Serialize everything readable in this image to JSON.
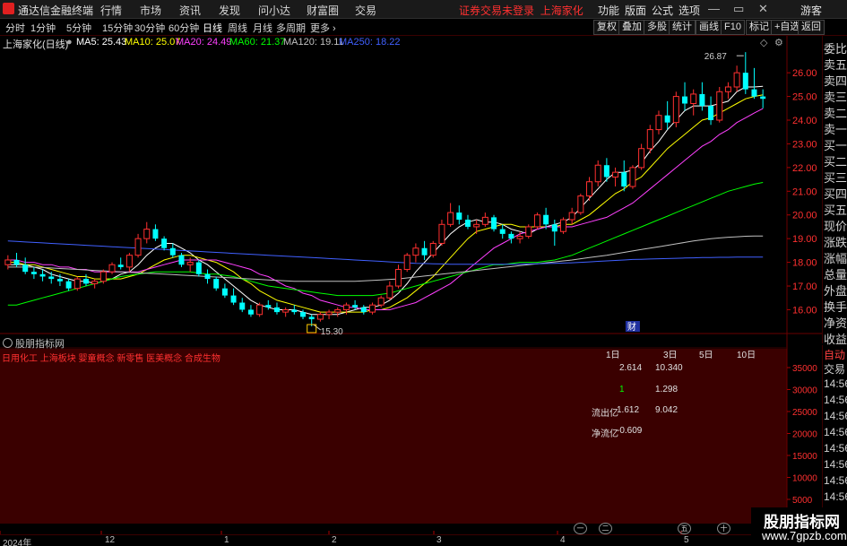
{
  "titlebar": {
    "app_title": "通达信金融终端",
    "menus": [
      "行情",
      "市场",
      "资讯",
      "发现",
      "问小达",
      "财富圈",
      "交易"
    ],
    "notice": "证券交易未登录",
    "notice_stock": "上海家化",
    "right_menus": [
      "功能",
      "版面",
      "公式",
      "选项"
    ],
    "guest": "游客",
    "win_min": "—",
    "win_max": "▭",
    "win_close": "✕"
  },
  "toolbar": {
    "periods": [
      "分时",
      "1分钟",
      "5分钟",
      "15分钟",
      "30分钟",
      "60分钟",
      "日线",
      "周线",
      "月线",
      "多周期",
      "更多"
    ],
    "active_period": "日线",
    "buttons": [
      "复权",
      "叠加",
      "多股",
      "统计",
      "画线",
      "F10",
      "标记",
      "+自选",
      "返回"
    ]
  },
  "chart_header": {
    "stock": "上海家化(日线)",
    "ma": [
      {
        "label": "MA5: 25.43",
        "color": "#ffffff"
      },
      {
        "label": "MA10: 25.07",
        "color": "#ffff00"
      },
      {
        "label": "MA20: 24.49",
        "color": "#ff40ff"
      },
      {
        "label": "MA60: 21.37",
        "color": "#00ff00"
      },
      {
        "label": "MA120: 19.11",
        "color": "#c0c0c0"
      },
      {
        "label": "MA250: 18.22",
        "color": "#4060ff"
      }
    ]
  },
  "quote_side": [
    "委比",
    "卖五",
    "卖四",
    "卖三",
    "卖二",
    "卖一",
    "买一",
    "买二",
    "买三",
    "买四",
    "买五",
    "现价",
    "涨跌",
    "涨幅",
    "总量",
    "外盘",
    "换手",
    "净资",
    "收益"
  ],
  "tick_side": [
    "自动",
    "交易",
    "14:56",
    "14:56",
    "14:56",
    "14:56",
    "14:56",
    "14:56",
    "14:56",
    "14:56"
  ],
  "chart_data": {
    "type": "candlestick",
    "price_axis_ticks": [
      "26.00",
      "25.00",
      "24.00",
      "23.00",
      "22.00",
      "21.00",
      "20.00",
      "19.00",
      "18.00",
      "17.00",
      "16.00"
    ],
    "y_range": [
      15.45,
      26.8
    ],
    "annotations": {
      "high": "26.87",
      "low": "15.30",
      "marker": "财"
    },
    "candles": [
      [
        17.9,
        18.3,
        17.7,
        18.1
      ],
      [
        18.1,
        18.4,
        17.8,
        17.9
      ],
      [
        17.9,
        18.2,
        17.5,
        17.6
      ],
      [
        17.6,
        17.8,
        17.3,
        17.5
      ],
      [
        17.5,
        17.7,
        17.2,
        17.4
      ],
      [
        17.4,
        17.6,
        17.1,
        17.3
      ],
      [
        17.3,
        17.5,
        17.0,
        17.2
      ],
      [
        17.2,
        17.3,
        16.8,
        16.9
      ],
      [
        16.9,
        17.4,
        16.8,
        17.3
      ],
      [
        17.3,
        17.5,
        17.0,
        17.1
      ],
      [
        17.1,
        17.3,
        16.9,
        17.2
      ],
      [
        17.2,
        17.7,
        17.1,
        17.6
      ],
      [
        17.6,
        18.0,
        17.5,
        17.9
      ],
      [
        17.9,
        18.2,
        17.7,
        17.8
      ],
      [
        17.8,
        18.4,
        17.6,
        18.3
      ],
      [
        18.3,
        19.2,
        18.2,
        19.0
      ],
      [
        19.0,
        19.7,
        18.8,
        19.4
      ],
      [
        19.4,
        19.6,
        18.9,
        19.0
      ],
      [
        19.0,
        19.1,
        18.5,
        18.6
      ],
      [
        18.6,
        18.8,
        18.2,
        18.3
      ],
      [
        18.3,
        18.4,
        17.8,
        17.9
      ],
      [
        17.9,
        18.2,
        17.6,
        18.0
      ],
      [
        18.0,
        18.1,
        17.4,
        17.5
      ],
      [
        17.5,
        17.7,
        17.1,
        17.3
      ],
      [
        17.3,
        17.4,
        16.8,
        16.9
      ],
      [
        16.9,
        17.1,
        16.5,
        16.6
      ],
      [
        16.6,
        16.9,
        16.2,
        16.3
      ],
      [
        16.3,
        16.5,
        15.9,
        16.0
      ],
      [
        16.0,
        16.2,
        15.7,
        15.8
      ],
      [
        15.8,
        16.3,
        15.7,
        16.2
      ],
      [
        16.2,
        16.4,
        16.0,
        16.1
      ],
      [
        16.1,
        16.3,
        15.8,
        15.9
      ],
      [
        15.9,
        16.1,
        15.7,
        16.0
      ],
      [
        16.0,
        16.2,
        15.8,
        15.9
      ],
      [
        15.9,
        16.0,
        15.6,
        15.7
      ],
      [
        15.7,
        15.8,
        15.3,
        15.6
      ],
      [
        15.6,
        15.9,
        15.5,
        15.8
      ],
      [
        15.8,
        16.0,
        15.6,
        15.9
      ],
      [
        15.9,
        16.1,
        15.7,
        16.0
      ],
      [
        16.0,
        16.3,
        15.8,
        16.2
      ],
      [
        16.2,
        16.4,
        16.0,
        16.1
      ],
      [
        16.1,
        16.2,
        15.8,
        15.9
      ],
      [
        15.9,
        16.3,
        15.8,
        16.2
      ],
      [
        16.2,
        16.6,
        16.1,
        16.5
      ],
      [
        16.5,
        17.2,
        16.4,
        17.0
      ],
      [
        17.0,
        17.9,
        16.9,
        17.7
      ],
      [
        17.7,
        18.4,
        17.6,
        18.3
      ],
      [
        18.3,
        18.8,
        18.0,
        18.6
      ],
      [
        18.6,
        18.9,
        18.1,
        18.3
      ],
      [
        18.3,
        18.9,
        18.2,
        18.8
      ],
      [
        18.8,
        19.8,
        18.7,
        19.6
      ],
      [
        19.6,
        20.5,
        19.5,
        20.1
      ],
      [
        20.1,
        20.4,
        19.6,
        19.8
      ],
      [
        19.8,
        20.0,
        19.4,
        19.5
      ],
      [
        19.5,
        19.8,
        19.2,
        19.6
      ],
      [
        19.6,
        20.1,
        19.5,
        19.9
      ],
      [
        19.9,
        20.0,
        19.3,
        19.4
      ],
      [
        19.4,
        19.6,
        19.0,
        19.2
      ],
      [
        19.2,
        19.3,
        18.8,
        19.0
      ],
      [
        19.0,
        19.3,
        18.8,
        19.1
      ],
      [
        19.1,
        19.6,
        19.0,
        19.5
      ],
      [
        19.5,
        20.1,
        19.4,
        20.0
      ],
      [
        20.0,
        20.3,
        19.4,
        19.6
      ],
      [
        19.6,
        19.8,
        18.7,
        19.3
      ],
      [
        19.3,
        19.9,
        19.2,
        19.8
      ],
      [
        19.8,
        20.3,
        19.6,
        20.1
      ],
      [
        20.1,
        20.9,
        20.0,
        20.8
      ],
      [
        20.8,
        21.6,
        20.6,
        21.4
      ],
      [
        21.4,
        22.3,
        21.2,
        22.1
      ],
      [
        22.1,
        22.4,
        21.4,
        21.6
      ],
      [
        21.6,
        22.0,
        21.2,
        21.8
      ],
      [
        21.8,
        22.3,
        21.0,
        21.2
      ],
      [
        21.2,
        22.1,
        21.1,
        22.0
      ],
      [
        22.0,
        23.0,
        21.9,
        22.8
      ],
      [
        22.8,
        23.8,
        22.6,
        23.6
      ],
      [
        23.6,
        24.4,
        23.4,
        24.2
      ],
      [
        24.2,
        24.8,
        23.6,
        23.9
      ],
      [
        23.9,
        25.2,
        23.7,
        25.0
      ],
      [
        25.0,
        25.6,
        24.4,
        24.7
      ],
      [
        24.7,
        25.3,
        24.2,
        25.1
      ],
      [
        25.1,
        25.6,
        24.4,
        24.6
      ],
      [
        24.6,
        25.0,
        23.8,
        24.0
      ],
      [
        24.0,
        25.4,
        23.9,
        25.2
      ],
      [
        25.2,
        25.6,
        24.9,
        25.4
      ],
      [
        25.4,
        26.3,
        25.2,
        26.0
      ],
      [
        26.0,
        26.87,
        25.1,
        25.3
      ],
      [
        25.3,
        26.2,
        24.9,
        25.0
      ],
      [
        25.0,
        25.3,
        24.5,
        24.9
      ]
    ],
    "ma_series": {
      "MA5": [
        17.9,
        17.9,
        17.9,
        17.8,
        17.7,
        17.5,
        17.4,
        17.3,
        17.2,
        17.2,
        17.1,
        17.2,
        17.3,
        17.5,
        17.6,
        17.9,
        18.3,
        18.6,
        18.8,
        18.8,
        18.6,
        18.4,
        18.1,
        17.9,
        17.6,
        17.3,
        17.0,
        16.7,
        16.4,
        16.2,
        16.1,
        16.0,
        16.0,
        16.0,
        15.9,
        15.8,
        15.8,
        15.8,
        15.8,
        15.9,
        16.0,
        16.1,
        16.1,
        16.2,
        16.4,
        16.7,
        17.1,
        17.6,
        18.0,
        18.4,
        18.8,
        19.2,
        19.5,
        19.7,
        19.8,
        19.7,
        19.7,
        19.6,
        19.4,
        19.3,
        19.2,
        19.4,
        19.5,
        19.6,
        19.7,
        19.9,
        20.3,
        20.7,
        21.1,
        21.5,
        21.8,
        21.8,
        21.9,
        22.2,
        22.7,
        23.1,
        23.6,
        24.0,
        24.4,
        24.6,
        24.6,
        24.6,
        24.7,
        24.8,
        25.2,
        25.4,
        25.4,
        25.43
      ],
      "MA10": [
        18.0,
        18.0,
        17.9,
        17.9,
        17.8,
        17.7,
        17.6,
        17.5,
        17.4,
        17.4,
        17.3,
        17.3,
        17.3,
        17.3,
        17.4,
        17.5,
        17.7,
        17.9,
        18.1,
        18.2,
        18.3,
        18.3,
        18.2,
        18.1,
        18.0,
        17.8,
        17.6,
        17.3,
        17.1,
        16.8,
        16.6,
        16.4,
        16.3,
        16.2,
        16.1,
        16.0,
        15.9,
        15.9,
        15.9,
        15.9,
        15.9,
        15.9,
        16.0,
        16.0,
        16.1,
        16.3,
        16.5,
        16.8,
        17.1,
        17.4,
        17.8,
        18.2,
        18.6,
        19.0,
        19.3,
        19.4,
        19.5,
        19.6,
        19.6,
        19.5,
        19.5,
        19.5,
        19.5,
        19.5,
        19.6,
        19.6,
        19.8,
        20.0,
        20.3,
        20.6,
        20.9,
        21.1,
        21.4,
        21.6,
        22.0,
        22.4,
        22.8,
        23.1,
        23.4,
        23.7,
        24.0,
        24.1,
        24.3,
        24.5,
        24.7,
        24.9,
        25.0,
        25.07
      ],
      "MA20": [
        18.1,
        18.1,
        18.0,
        18.0,
        17.9,
        17.9,
        17.8,
        17.8,
        17.7,
        17.7,
        17.6,
        17.6,
        17.6,
        17.6,
        17.6,
        17.6,
        17.7,
        17.8,
        17.9,
        18.0,
        18.1,
        18.1,
        18.1,
        18.1,
        18.1,
        18.0,
        17.9,
        17.8,
        17.7,
        17.5,
        17.4,
        17.2,
        17.0,
        16.9,
        16.7,
        16.6,
        16.4,
        16.3,
        16.2,
        16.1,
        16.1,
        16.0,
        16.0,
        16.0,
        16.0,
        16.1,
        16.2,
        16.3,
        16.5,
        16.7,
        16.9,
        17.1,
        17.4,
        17.7,
        18.0,
        18.3,
        18.6,
        18.8,
        19.0,
        19.2,
        19.3,
        19.4,
        19.5,
        19.5,
        19.5,
        19.5,
        19.6,
        19.7,
        19.8,
        19.9,
        20.1,
        20.3,
        20.5,
        20.8,
        21.1,
        21.4,
        21.7,
        22.0,
        22.3,
        22.6,
        22.9,
        23.1,
        23.4,
        23.6,
        23.9,
        24.1,
        24.3,
        24.49
      ],
      "MA60": [
        16.2,
        16.2,
        16.3,
        16.4,
        16.5,
        16.6,
        16.7,
        16.8,
        16.9,
        17.0,
        17.1,
        17.2,
        17.3,
        17.4,
        17.45,
        17.5,
        17.55,
        17.6,
        17.6,
        17.6,
        17.6,
        17.6,
        17.55,
        17.5,
        17.5,
        17.45,
        17.4,
        17.3,
        17.2,
        17.1,
        17.0,
        16.95,
        16.9,
        16.85,
        16.8,
        16.75,
        16.7,
        16.65,
        16.6,
        16.6,
        16.6,
        16.6,
        16.6,
        16.65,
        16.7,
        16.8,
        16.9,
        17.0,
        17.1,
        17.2,
        17.3,
        17.4,
        17.5,
        17.6,
        17.7,
        17.8,
        17.9,
        17.9,
        17.95,
        18.0,
        18.0,
        18.0,
        18.05,
        18.1,
        18.2,
        18.3,
        18.45,
        18.6,
        18.75,
        18.9,
        19.05,
        19.2,
        19.35,
        19.5,
        19.65,
        19.8,
        19.95,
        20.1,
        20.25,
        20.4,
        20.55,
        20.7,
        20.85,
        21.0,
        21.1,
        21.2,
        21.3,
        21.37
      ],
      "MA120": [
        17.8,
        17.8,
        17.8,
        17.8,
        17.78,
        17.76,
        17.74,
        17.72,
        17.7,
        17.68,
        17.66,
        17.64,
        17.62,
        17.6,
        17.58,
        17.56,
        17.54,
        17.52,
        17.5,
        17.48,
        17.46,
        17.44,
        17.42,
        17.4,
        17.38,
        17.36,
        17.34,
        17.32,
        17.3,
        17.28,
        17.26,
        17.24,
        17.22,
        17.2,
        17.2,
        17.2,
        17.2,
        17.2,
        17.2,
        17.2,
        17.2,
        17.22,
        17.24,
        17.26,
        17.28,
        17.3,
        17.34,
        17.38,
        17.42,
        17.46,
        17.5,
        17.54,
        17.58,
        17.62,
        17.66,
        17.7,
        17.74,
        17.78,
        17.82,
        17.86,
        17.9,
        17.94,
        17.98,
        18.02,
        18.06,
        18.1,
        18.15,
        18.2,
        18.25,
        18.3,
        18.36,
        18.42,
        18.48,
        18.54,
        18.6,
        18.66,
        18.72,
        18.78,
        18.84,
        18.9,
        18.95,
        19.0,
        19.03,
        19.06,
        19.08,
        19.1,
        19.11,
        19.11
      ],
      "MA250": [
        18.9,
        18.88,
        18.86,
        18.84,
        18.82,
        18.8,
        18.78,
        18.76,
        18.74,
        18.72,
        18.7,
        18.68,
        18.66,
        18.64,
        18.62,
        18.6,
        18.58,
        18.56,
        18.54,
        18.52,
        18.5,
        18.48,
        18.46,
        18.44,
        18.42,
        18.4,
        18.38,
        18.36,
        18.34,
        18.32,
        18.3,
        18.28,
        18.26,
        18.24,
        18.22,
        18.2,
        18.18,
        18.16,
        18.14,
        18.12,
        18.1,
        18.08,
        18.06,
        18.04,
        18.02,
        18.0,
        17.98,
        17.96,
        17.95,
        17.94,
        17.93,
        17.92,
        17.92,
        17.92,
        17.92,
        17.92,
        17.92,
        17.92,
        17.92,
        17.92,
        17.93,
        17.94,
        17.95,
        17.96,
        17.97,
        17.98,
        18.0,
        18.02,
        18.04,
        18.06,
        18.08,
        18.1,
        18.12,
        18.13,
        18.14,
        18.15,
        18.16,
        18.17,
        18.18,
        18.19,
        18.2,
        18.2,
        18.21,
        18.21,
        18.22,
        18.22,
        18.22,
        18.22
      ]
    }
  },
  "indicator": {
    "title": "股朋指标网",
    "concepts": "日用化工 上海板块 婴童概念 新零售 医美概念 合成生物",
    "flow_headers": [
      "1日",
      "3日",
      "5日",
      "10日"
    ],
    "flow_rows": [
      {
        "label": "",
        "v1": "2.614",
        "v2": "10.340"
      },
      {
        "label": "",
        "v1": "1",
        "v2": "1.298"
      },
      {
        "label": "流出亿",
        "v1": "1.612",
        "v2": "9.042"
      },
      {
        "label": "净流亿",
        "v1": "-0.609",
        "v2": ""
      }
    ],
    "axis_ticks": [
      "35000",
      "30000",
      "25000",
      "20000",
      "15000",
      "10000",
      "5000"
    ]
  },
  "bottom_dates": [
    "2024年",
    "12",
    "1",
    "2",
    "3",
    "4",
    "5"
  ],
  "bottom_circles": [
    "一",
    "二",
    "五",
    "十"
  ],
  "watermark": {
    "line1": "股朋指标网",
    "line2": "www.7gpzb.com"
  }
}
